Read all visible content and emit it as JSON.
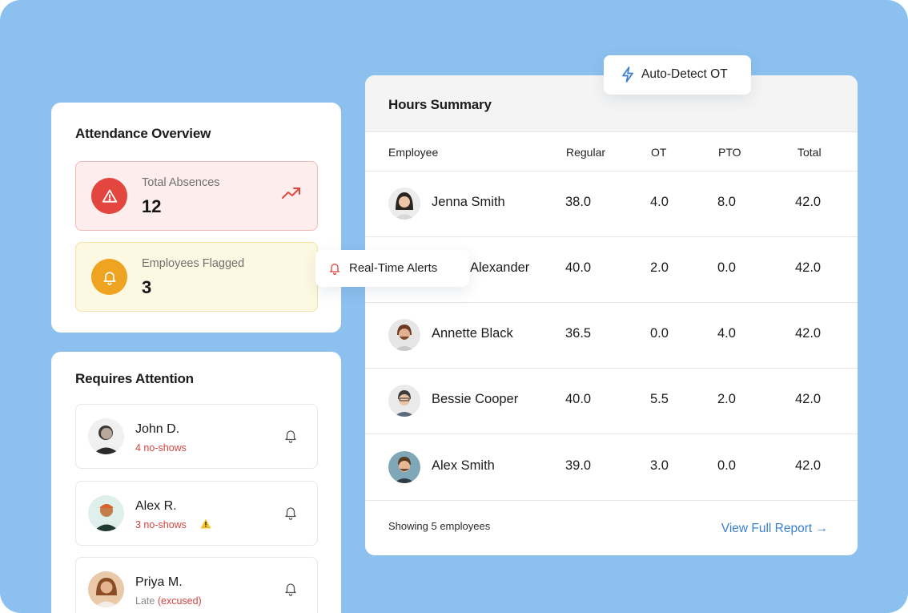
{
  "attendance": {
    "title": "Attendance Overview",
    "total_absences": {
      "label": "Total Absences",
      "value": "12",
      "trend": "up"
    },
    "employees_flagged": {
      "label": "Employees Flagged",
      "value": "3"
    }
  },
  "requires_attention": {
    "title": "Requires Attention",
    "items": [
      {
        "name": "John D.",
        "status": "4 no-shows"
      },
      {
        "name": "Alex R.",
        "status": "3 no-shows",
        "warning": true
      },
      {
        "name": "Priya M.",
        "status_muted": "Late",
        "status": "(excused)"
      }
    ]
  },
  "hours_summary": {
    "title": "Hours Summary",
    "columns": {
      "employee": "Employee",
      "regular": "Regular",
      "ot": "OT",
      "pto": "PTO",
      "total": "Total"
    },
    "rows": [
      {
        "name": "Jenna Smith",
        "regular": "38.0",
        "ot": "4.0",
        "pto": "8.0",
        "total": "42.0"
      },
      {
        "name": "Alexander",
        "regular": "40.0",
        "ot": "2.0",
        "pto": "0.0",
        "total": "42.0"
      },
      {
        "name": "Annette Black",
        "regular": "36.5",
        "ot": "0.0",
        "pto": "4.0",
        "total": "42.0"
      },
      {
        "name": "Bessie Cooper",
        "regular": "40.0",
        "ot": "5.5",
        "pto": "2.0",
        "total": "42.0"
      },
      {
        "name": "Alex Smith",
        "regular": "39.0",
        "ot": "3.0",
        "pto": "0.0",
        "total": "42.0"
      }
    ],
    "footer": {
      "count_text": "Showing 5 employees",
      "link": "View Full Report →"
    }
  },
  "badges": {
    "auto_detect": "Auto-Detect OT",
    "real_time_alerts": "Real-Time Alerts"
  },
  "colors": {
    "background": "#8cc0ee",
    "danger": "#e2463e",
    "warning": "#eea420",
    "link": "#3b7fd0"
  },
  "icons": {
    "absences": "warning-triangle-icon",
    "trend": "trending-up-icon",
    "flagged": "bell-icon",
    "auto_detect": "lightning-bolt-icon",
    "alerts": "bell-icon"
  }
}
